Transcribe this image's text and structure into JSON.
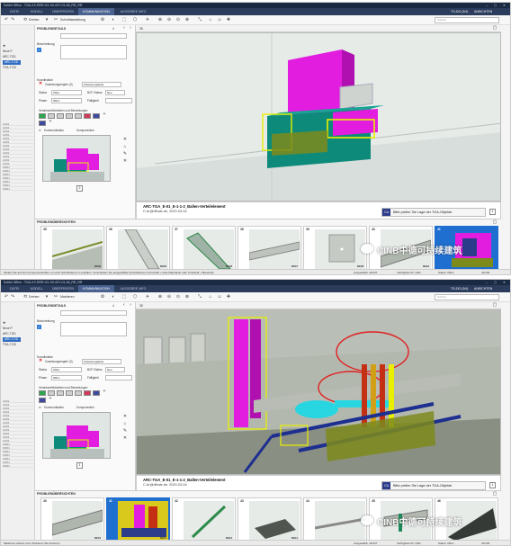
{
  "windows": [
    {
      "title": "Solibri Office - TGA-XX-RRR-XX-XX-007-01-08_RR_RR",
      "tabs": [
        "DATEI",
        "MODELL",
        "ÜBERPRÜFEN",
        "KOMMUNIKATION",
        "AUSGEBRE INFO"
      ],
      "active_tab": 3,
      "tab_right": [
        "TO-DO (3/4)",
        "ANSICHTEN"
      ],
      "toolbar": {
        "drehen": "Drehen",
        "tool2": "Schnittdarstellung",
        "search_placeholder": "Suchen"
      },
      "left": {
        "items": [
          "Neue P.",
          "ARC-TGD",
          "ARC-T.GD",
          "TGA-T.GD"
        ],
        "selected": 2,
        "lines": [
          "AUS1",
          "AUS1",
          "AUS1",
          "AUS1",
          "AUS1",
          "AUS1",
          "AUS1",
          "AUS1",
          "AUS1",
          "AUS1",
          "AUS1",
          "AUS1",
          "IOF01",
          "IOF01",
          "IOF01",
          "IOF01",
          "IOF01",
          "IOF01",
          "IOF01"
        ]
      },
      "detail": {
        "header": "PROBLEMDETAILS",
        "count": "4",
        "description_label": "Beschreibung",
        "coordination_label": "Koordination",
        "assign_label": "Zuweisungsregeln (3)",
        "assign_value": "Zuweisungsleiter",
        "status_label": "Status",
        "status_value": "Offen",
        "bcf_label": "BCF-Status",
        "bcf_value": "Neu",
        "phase_label": "Phase",
        "phase_value": "NRL1",
        "due_label": "Fälligkeit",
        "resp_label": "Verantwortlichkeiten und Bewertungen",
        "comm_tab": "Kommunikation",
        "comp_tab": "Komponenten",
        "page": "2"
      },
      "viewport_label": "3D",
      "issue": {
        "title": "ARC-TGA_E-01_E-1-1-2_Ballen-Verteilelement",
        "author": "C.Ar@dfirale.de, 2020-03-04",
        "comment": "Bitte prüfen Sie Lage der TGA-Objekte.",
        "avatar": "CA",
        "badge": "1",
        "nav_filter": "Offen",
        "nav_page": "1",
        "nav_total": "2"
      },
      "strip": {
        "header": "PROBLEMÜBERSICHTEN",
        "cards": [
          {
            "num": "35",
            "label": "NK08"
          },
          {
            "num": "36",
            "label": "NK06"
          },
          {
            "num": "37",
            "label": "NK06"
          },
          {
            "num": "38",
            "label": "NK07"
          },
          {
            "num": "39",
            "label": "NK08"
          },
          {
            "num": "40",
            "label": "NK04"
          },
          {
            "num": "41",
            "label": ""
          }
        ],
        "selected": 6
      },
      "watermark": "CINB中德可持续建筑",
      "status": {
        "left": "Klicken Sie auf den Komponentenfilter, um eine Schnittebene zu erstellen. Verschieben Sie ausgewählte Schnittebenen (Umschalt + linke Maustaste oder Umschalt + Mausrad)",
        "sel": "Ausgewählt: 40/137",
        "vis": "Verfügbare ID: 1041",
        "st": "Status: Offen",
        "ratio": "41/136"
      }
    },
    {
      "title": "Solibri Office - TGA-XX-RRR-XX-XX-007-01-08_RR_RR",
      "tabs": [
        "DATEI",
        "MODELL",
        "ÜBERPRÜFEN",
        "KOMMUNIKATION",
        "AUSGEBRE INFO"
      ],
      "active_tab": 3,
      "tab_right": [
        "TO-DO (3/4)",
        "ANSICHTEN"
      ],
      "toolbar": {
        "drehen": "Drehen",
        "tool2": "Markieren",
        "search_placeholder": "Suchen"
      },
      "left": {
        "items": [
          "Neue P.",
          "ARC-TGD",
          "ARC-T.GD",
          "TGA-T.GD"
        ],
        "selected": 2,
        "lines": [
          "AUS1",
          "AUS1",
          "AUS1",
          "AUS1",
          "AUS1",
          "AUS1",
          "AUS1",
          "AUS1",
          "AUS1",
          "AUS1",
          "AUS1",
          "AUS1",
          "IOF01",
          "IOF01",
          "IOF01",
          "IOF01",
          "IOF01",
          "IOF01",
          "IOF01"
        ]
      },
      "detail": {
        "header": "PROBLEMDETAILS",
        "count": "4",
        "description_label": "Beschreibung",
        "coordination_label": "Koordination",
        "assign_label": "Zuweisungsregeln (3)",
        "assign_value": "Zuweisungsleiter",
        "status_label": "Status",
        "status_value": "Offen",
        "bcf_label": "BCF-Status",
        "bcf_value": "Neu",
        "phase_label": "Phase",
        "phase_value": "NRL1",
        "due_label": "Fälligkeit",
        "resp_label": "Verantwortlichkeiten und Bewertungen",
        "comm_tab": "Kommunikation",
        "comp_tab": "Komponenten",
        "page": "1"
      },
      "viewport_label": "3D",
      "issue": {
        "title": "ARC-TGA_E-01_E-1-1-2_Ballen-Verteilelement",
        "author": "C.Ar@dfirale.de, 2020-03-04",
        "comment": "Bitte prüfen Sie Lage der TGA-Objekte.",
        "avatar": "CA",
        "badge": "1",
        "nav_filter": "Offen",
        "nav_page": "1",
        "nav_total": "2"
      },
      "strip": {
        "header": "PROBLEMÜBERSICHTEN",
        "cards": [
          {
            "num": "40",
            "label": "NK04"
          },
          {
            "num": "41",
            "label": "NK11"
          },
          {
            "num": "42",
            "label": "NK12"
          },
          {
            "num": "43",
            "label": "NK13"
          },
          {
            "num": "44",
            "label": ""
          },
          {
            "num": "45",
            "label": ""
          },
          {
            "num": "46",
            "label": ""
          }
        ],
        "selected": 1
      },
      "watermark": "CINB中德可持续建筑",
      "status": {
        "left": "Markieren starten (zum Aktivieren Sie drücken)",
        "sel": "Ausgewählt: 40/137",
        "vis": "Verfügbare ID: 1041",
        "st": "Status: Offen",
        "ratio": "41/136"
      }
    }
  ],
  "colors": {
    "titlebar": "#1b2a43",
    "tabbar": "#2b3c5c",
    "active_tab": "#4a6290",
    "selection": "#1f6fd1",
    "magenta": "#e21de0",
    "teal": "#0e8a7a",
    "olive": "#7d8a1c"
  },
  "icons": [
    "undo-icon",
    "redo-icon",
    "rotate-icon",
    "zoom-icon",
    "camera-icon",
    "close-icon",
    "chevron-down-icon",
    "search-icon",
    "checkbox-icon",
    "delete-icon",
    "maximize-icon",
    "comment-icon"
  ]
}
